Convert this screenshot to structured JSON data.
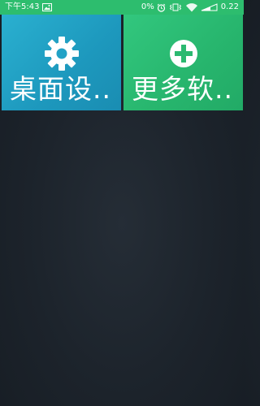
{
  "status_bar": {
    "time": "下午5:43",
    "battery_percent": "0%",
    "network_speed": "0.22",
    "icons": [
      "image-icon",
      "alarm-icon",
      "vibrate-icon",
      "wifi-icon",
      "signal-icon"
    ]
  },
  "tiles": [
    {
      "label": "桌面设..",
      "icon": "gear-icon",
      "color": "#23a5c9"
    },
    {
      "label": "更多软..",
      "icon": "plus-circle-icon",
      "color": "#2dbd6e"
    }
  ],
  "colors": {
    "status_bar": "#2dbd6e",
    "background": "#1c232b"
  }
}
